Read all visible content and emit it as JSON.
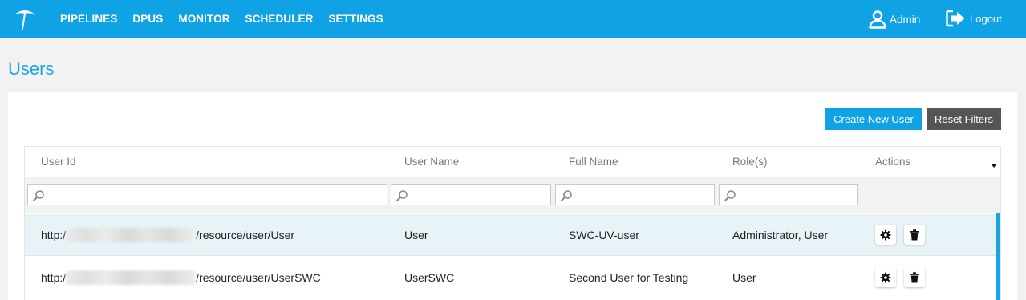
{
  "nav": {
    "items": [
      "PIPELINES",
      "DPUS",
      "MONITOR",
      "SCHEDULER",
      "SETTINGS"
    ],
    "user_label": "Admin",
    "logout_label": "Logout"
  },
  "page": {
    "title": "Users"
  },
  "toolbar": {
    "create_label": "Create New User",
    "reset_label": "Reset Filters"
  },
  "table": {
    "columns": [
      "User Id",
      "User Name",
      "Full Name",
      "Role(s)",
      "Actions"
    ],
    "rows": [
      {
        "id_prefix": "http:/",
        "id_suffix": "/resource/user/User",
        "user_name": "User",
        "full_name": "SWC-UV-user",
        "roles": "Administrator, User"
      },
      {
        "id_prefix": "http:/",
        "id_suffix": "/resource/user/UserSWC",
        "user_name": "UserSWC",
        "full_name": "Second User for Testing",
        "roles": "User"
      }
    ]
  },
  "colors": {
    "accent": "#0fa3e6",
    "title": "#1aa3e6",
    "reset": "#555555",
    "selected_row": "#e8f3f8"
  },
  "icons": {
    "logo": "umbrella-logo-icon",
    "user": "user-icon",
    "logout": "logout-icon",
    "search": "search-icon",
    "settings": "gear-icon",
    "delete": "trash-icon",
    "sort": "caret-down-icon"
  }
}
